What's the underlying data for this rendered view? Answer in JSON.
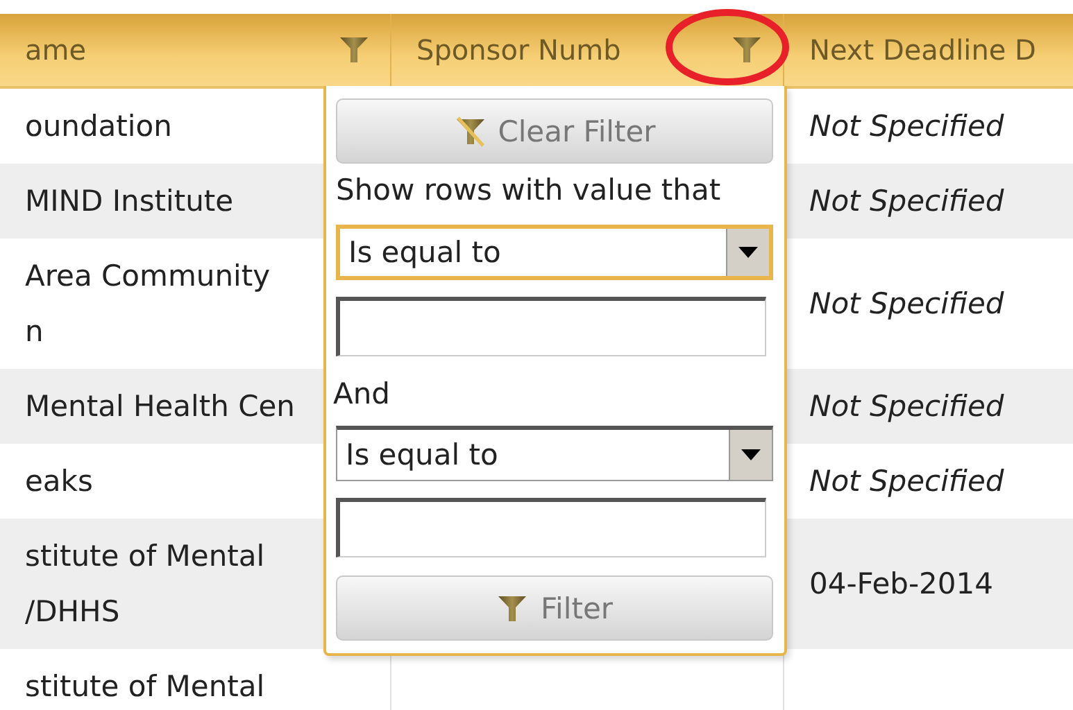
{
  "table": {
    "columns": [
      {
        "label": "ame",
        "filter": true
      },
      {
        "label": "Sponsor Numb",
        "filter": true,
        "highlighted": true
      },
      {
        "label": "Next Deadline D",
        "filter": false
      }
    ],
    "rows": [
      {
        "cells": [
          "oundation"
        ],
        "italic": true,
        "deadline": "Not Specified"
      },
      {
        "cells": [
          "MIND Institute"
        ],
        "italic": true,
        "deadline": "Not Specified"
      },
      {
        "cells": [
          "Area Community\nn"
        ],
        "italic": true,
        "deadline": "Not Specified"
      },
      {
        "cells": [
          "Mental Health Cen"
        ],
        "italic": true,
        "deadline": "Not Specified"
      },
      {
        "cells": [
          "eaks"
        ],
        "italic": true,
        "deadline": "Not Specified"
      },
      {
        "cells": [
          "stitute of Mental\n/DHHS"
        ],
        "italic": false,
        "deadline": "04-Feb-2014"
      },
      {
        "cells": [
          "stitute of Mental"
        ]
      }
    ]
  },
  "filter_popup": {
    "clear_button": "Clear Filter",
    "prompt": "Show rows with value that",
    "and_label": "And",
    "filter_button": "Filter",
    "conditions": [
      {
        "operator": "Is equal to",
        "focused": true
      },
      {
        "operator": "Is equal to",
        "focused": false
      }
    ]
  }
}
